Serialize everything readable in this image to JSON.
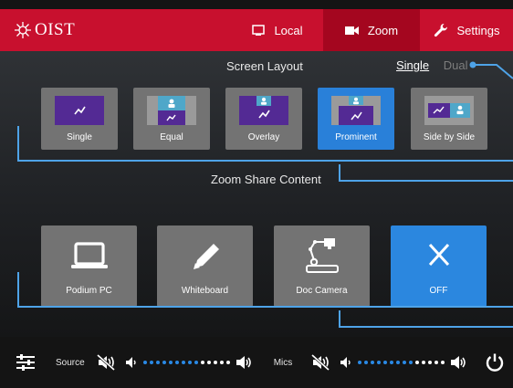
{
  "header": {
    "logo_text": "OIST",
    "tabs": [
      {
        "label": "Local",
        "icon": "monitor-icon"
      },
      {
        "label": "Zoom",
        "icon": "video-camera-icon",
        "active": true
      },
      {
        "label": "Settings",
        "icon": "wrench-icon"
      }
    ]
  },
  "screen_layout": {
    "title": "Screen Layout",
    "mode_single": "Single",
    "mode_dual": "Dual",
    "options": [
      {
        "label": "Single"
      },
      {
        "label": "Equal"
      },
      {
        "label": "Overlay"
      },
      {
        "label": "Prominent",
        "active": true
      },
      {
        "label": "Side by Side"
      }
    ]
  },
  "share_content": {
    "title": "Zoom Share Content",
    "options": [
      {
        "label": "Podium PC",
        "icon": "laptop-icon"
      },
      {
        "label": "Whiteboard",
        "icon": "pencil-icon"
      },
      {
        "label": "Doc Camera",
        "icon": "document-camera-icon"
      },
      {
        "label": "OFF",
        "icon": "close-icon",
        "active": true
      }
    ]
  },
  "bottom": {
    "source_label": "Source",
    "mics_label": "Mics",
    "source_level": 0.64,
    "mics_level": 0.64
  },
  "colors": {
    "brand_red": "#c8102e",
    "active_blue": "#2980d9",
    "callout_blue": "#4ea3e8"
  }
}
